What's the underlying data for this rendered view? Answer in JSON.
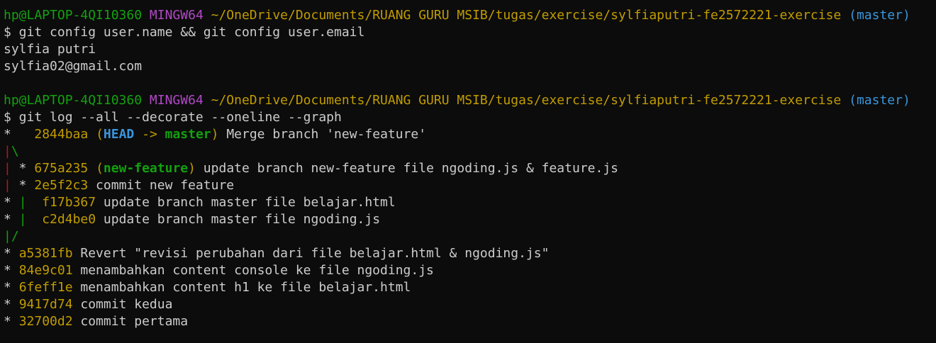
{
  "prompt1": {
    "user": "hp@LAPTOP-4QI10360",
    "system": "MINGW64",
    "path": "~/OneDrive/Documents/RUANG GURU MSIB/tugas/exercise/sylfiaputri-fe2572221-exercise",
    "branch": "(master)",
    "command": "$ git config user.name && git config user.email"
  },
  "config_output": {
    "name": "sylfia putri",
    "email": "sylfia02@gmail.com"
  },
  "prompt2": {
    "user": "hp@LAPTOP-4QI10360",
    "system": "MINGW64",
    "path": "~/OneDrive/Documents/RUANG GURU MSIB/tugas/exercise/sylfiaputri-fe2572221-exercise",
    "branch": "(master)",
    "command": "$ git log --all --decorate --oneline --graph"
  },
  "graph": {
    "merge": {
      "star": "*",
      "hash": "2844baa",
      "open": "(",
      "head": "HEAD",
      "arrow": " -> ",
      "ref": "master",
      "close": ")",
      "msg": " Merge branch 'new-feature'"
    },
    "split": {
      "pipe": "|",
      "slash": "\\"
    },
    "commit1": {
      "pipe": "|",
      "star": " * ",
      "hash": "675a235",
      "open": "(",
      "ref": "new-feature",
      "close": ")",
      "msg": " update branch new-feature file ngoding.js & feature.js"
    },
    "commit2": {
      "pipe": "|",
      "star": " * ",
      "hash": "2e5f2c3",
      "msg": " commit new feature"
    },
    "commit3": {
      "star": "* ",
      "pipe": "|",
      "hash": "f17b367",
      "msg": " update branch master file belajar.html"
    },
    "commit4": {
      "star": "* ",
      "pipe": "|",
      "hash": "c2d4be0",
      "msg": " update branch master file ngoding.js"
    },
    "join": {
      "pipe": "|",
      "slash": "/"
    },
    "linear": [
      {
        "star": "* ",
        "hash": "a5381fb",
        "msg": " Revert \"revisi perubahan dari file belajar.html & ngoding.js\""
      },
      {
        "star": "* ",
        "hash": "84e9c01",
        "msg": " menambahkan content console ke file ngoding.js"
      },
      {
        "star": "* ",
        "hash": "6feff1e",
        "msg": " menambahkan content h1 ke file belajar.html"
      },
      {
        "star": "* ",
        "hash": "9417d74",
        "msg": " commit kedua"
      },
      {
        "star": "* ",
        "hash": "32700d2",
        "msg": " commit pertama"
      }
    ]
  },
  "colors": {
    "background": "#0c0c0c",
    "text": "#cccccc",
    "user": "#13a10e",
    "system": "#b148c6",
    "path": "#c19c00",
    "branch": "#3a96dd",
    "graph_red": "#c50f1f",
    "graph_green": "#13a10e"
  }
}
